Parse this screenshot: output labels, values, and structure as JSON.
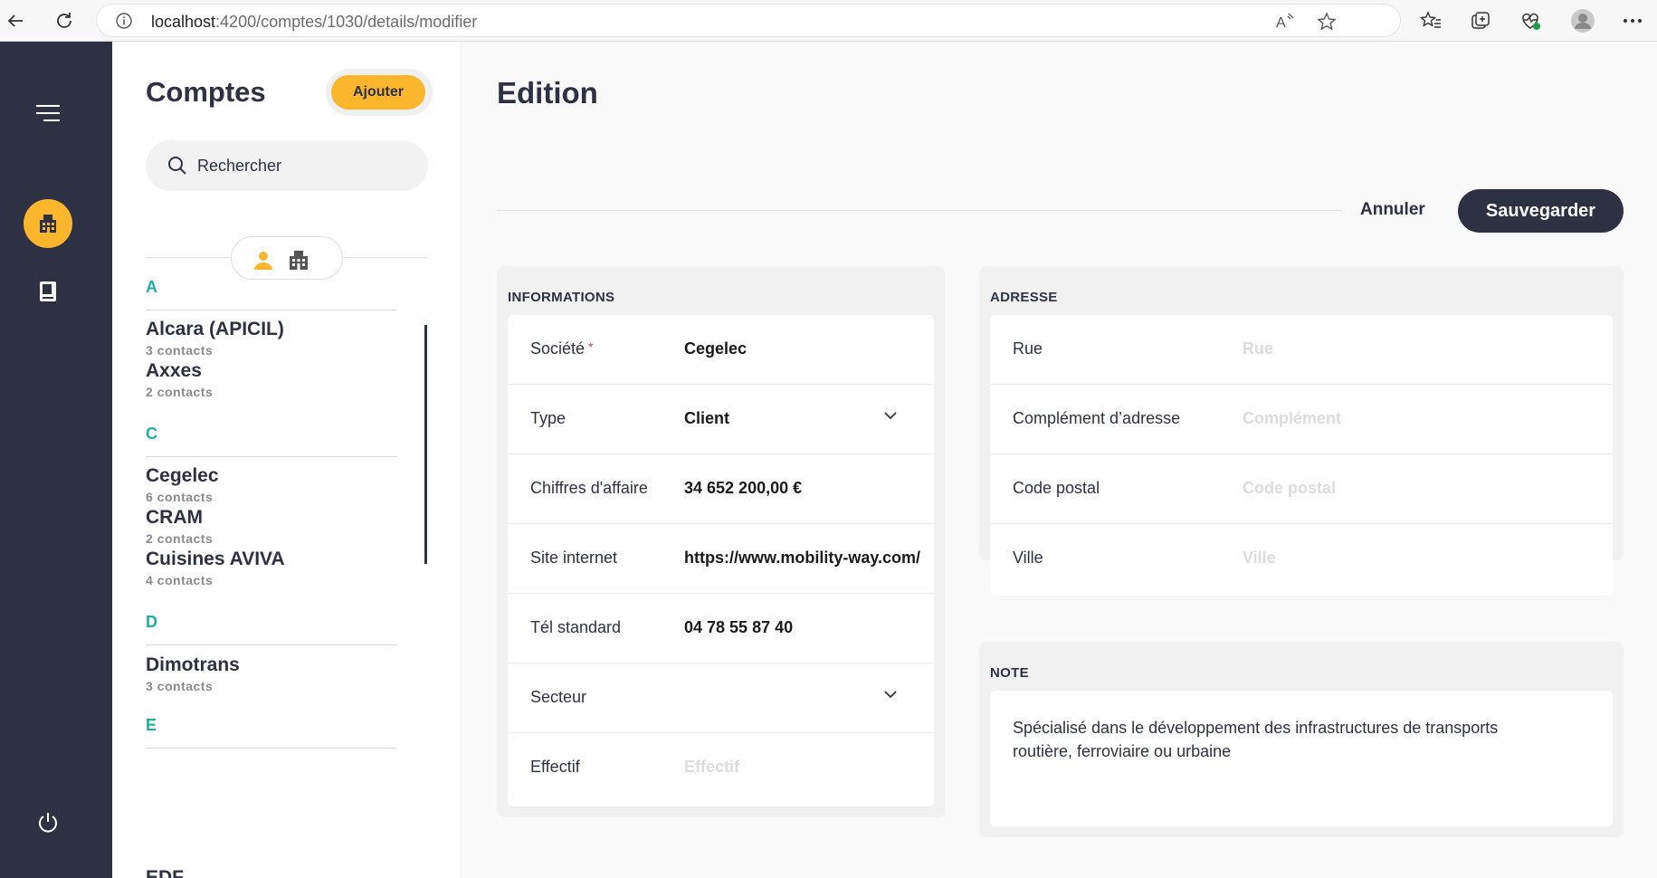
{
  "browser": {
    "url_host": "localhost",
    "url_path": ":4200/comptes/1030/details/modifier"
  },
  "list": {
    "title": "Comptes",
    "add_label": "Ajouter",
    "search_placeholder": "Rechercher",
    "groups": [
      {
        "letter": "A",
        "items": [
          {
            "name": "Alcara (APICIL)",
            "contacts": "3 contacts"
          },
          {
            "name": "Axxes",
            "contacts": "2 contacts"
          }
        ]
      },
      {
        "letter": "C",
        "items": [
          {
            "name": "Cegelec",
            "contacts": "6 contacts"
          },
          {
            "name": "CRAM",
            "contacts": "2 contacts"
          },
          {
            "name": "Cuisines AVIVA",
            "contacts": "4 contacts"
          }
        ]
      },
      {
        "letter": "D",
        "items": [
          {
            "name": "Dimotrans",
            "contacts": "3 contacts"
          }
        ]
      },
      {
        "letter": "E",
        "items": [
          {
            "name": "EDF",
            "contacts": ""
          }
        ]
      }
    ]
  },
  "main": {
    "title": "Edition",
    "cancel_label": "Annuler",
    "save_label": "Sauvegarder"
  },
  "informations": {
    "title": "INFORMATIONS",
    "societe": {
      "label": "Société",
      "required": "*",
      "value": "Cegelec"
    },
    "type": {
      "label": "Type",
      "value": "Client"
    },
    "ca": {
      "label": "Chiffres d'affaire",
      "value": "34 652 200,00 €"
    },
    "site": {
      "label": "Site internet",
      "value": "https://www.mobility-way.com/"
    },
    "tel": {
      "label": "Tél standard",
      "value": "04 78 55 87 40"
    },
    "secteur": {
      "label": "Secteur",
      "value": ""
    },
    "effectif": {
      "label": "Effectif",
      "placeholder": "Effectif"
    }
  },
  "adresse": {
    "title": "ADRESSE",
    "rue": {
      "label": "Rue",
      "placeholder": "Rue"
    },
    "complement": {
      "label": "Complément d’adresse",
      "placeholder": "Complément"
    },
    "cp": {
      "label": "Code postal",
      "placeholder": "Code postal"
    },
    "ville": {
      "label": "Ville",
      "placeholder": "Ville"
    }
  },
  "note": {
    "title": "NOTE",
    "text": "Spécialisé dans le développement des infrastructures de transports routière, ferroviaire ou urbaine"
  },
  "colors": {
    "accent": "#fbb62d",
    "dark": "#2d3142",
    "letter": "#1fae9f"
  }
}
